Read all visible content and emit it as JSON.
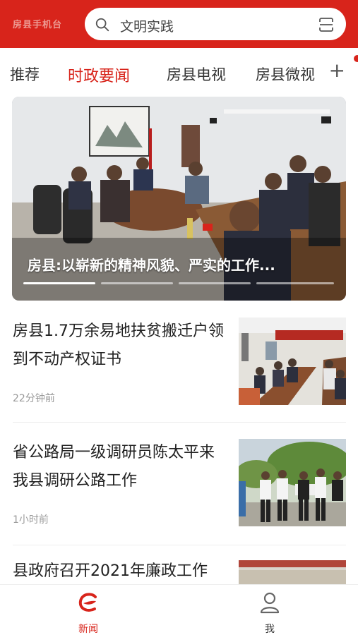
{
  "header": {
    "logo_text": "房县手机台",
    "search_placeholder": "文明实践"
  },
  "tabs": [
    {
      "label": "推荐",
      "active": false
    },
    {
      "label": "时政要闻",
      "active": true
    },
    {
      "label": "房县电视",
      "active": false
    },
    {
      "label": "房县微视",
      "active": false
    }
  ],
  "tab_add": "+",
  "hero": {
    "caption": "房县:以崭新的精神风貌、严实的工作..."
  },
  "news": [
    {
      "title": "房县1.7万余易地扶贫搬迁户领到不动产权证书",
      "time": "22分钟前"
    },
    {
      "title": "省公路局一级调研员陈太平来我县调研公路工作",
      "time": "1小时前"
    },
    {
      "title": "县政府召开2021年廉政工作",
      "time": ""
    }
  ],
  "bottom_nav": [
    {
      "label": "新闻",
      "active": true
    },
    {
      "label": "我",
      "active": false
    }
  ],
  "colors": {
    "brand_red": "#d8241b",
    "text_gray": "#999999"
  }
}
